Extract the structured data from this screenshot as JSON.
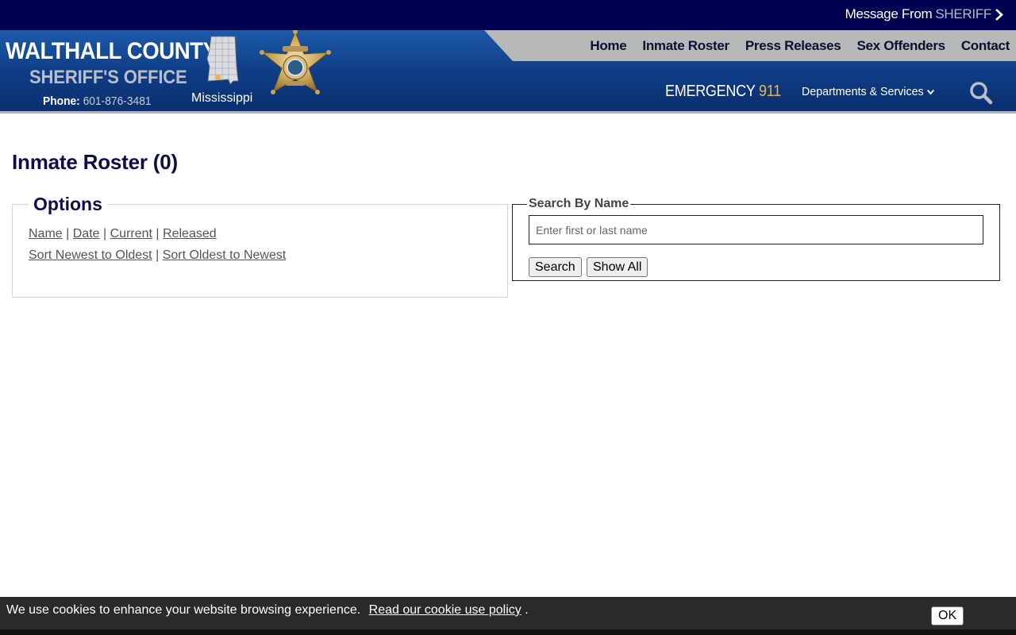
{
  "topbar": {
    "message_prefix": "Message From",
    "message_highlight": "SHERIFF"
  },
  "brand": {
    "title": "WALTHALL COUNTY",
    "subtitle": "SHERIFF'S OFFICE",
    "phone_label": "Phone:",
    "phone_number": "601-876-3481",
    "state_label": "Mississippi"
  },
  "nav": {
    "items": [
      {
        "label": "Home"
      },
      {
        "label": "Inmate Roster"
      },
      {
        "label": "Press Releases"
      },
      {
        "label": "Sex Offenders"
      },
      {
        "label": "Contact"
      }
    ]
  },
  "header": {
    "emergency_label": "EMERGENCY",
    "emergency_number": "911",
    "departments_label": "Departments & Services"
  },
  "main": {
    "page_title": "Inmate Roster (0)",
    "options": {
      "legend": "Options",
      "sort_links": [
        {
          "label": "Name"
        },
        {
          "label": "Date"
        },
        {
          "label": "Current"
        },
        {
          "label": "Released"
        }
      ],
      "order_links": [
        {
          "label": "Sort Newest to Oldest"
        },
        {
          "label": "Sort Oldest to Newest"
        }
      ],
      "separator": "|"
    },
    "search": {
      "legend": "Search By Name",
      "placeholder": "Enter first or last name",
      "value": "",
      "search_button": "Search",
      "show_all_button": "Show All"
    }
  },
  "cookie": {
    "text": "We use cookies to enhance your website browsing experience.",
    "link": "Read our cookie use policy",
    "suffix": ".",
    "ok_label": "OK"
  },
  "colors": {
    "topbar": "#000050",
    "header_blue": "#0e3e86",
    "nav_band": "#b7b8ba",
    "title_navy": "#0c0c4a",
    "emergency_accent": "#f0b24a"
  }
}
